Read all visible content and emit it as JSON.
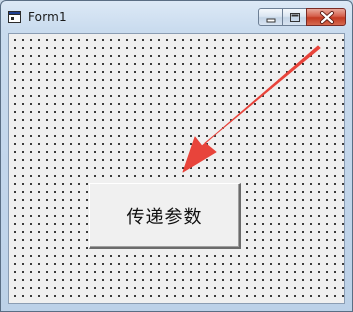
{
  "window": {
    "title": "Form1",
    "minimize_icon": "minimize-icon",
    "maximize_icon": "maximize-icon",
    "close_icon": "close-icon"
  },
  "form": {
    "button_label": "传递参数",
    "annotation": "red-arrow-pointing-to-button",
    "arrow_color": "#e8443b",
    "grid_dot_color": "#000000",
    "background_color": "#f0f0f0"
  }
}
